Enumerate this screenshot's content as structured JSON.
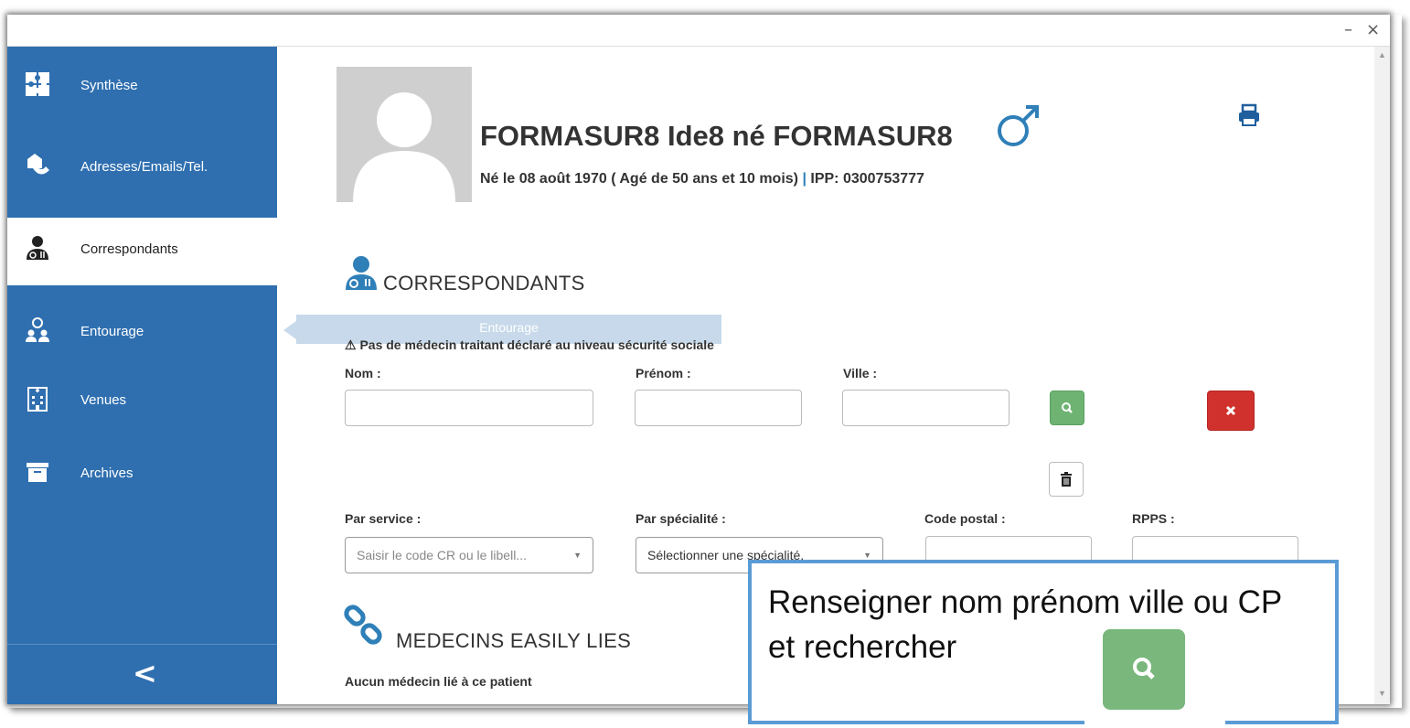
{
  "window": {
    "minimize_glyph": "–",
    "close_glyph": "×"
  },
  "sidebar": {
    "items": [
      {
        "label": "Synthèse",
        "icon": "puzzle-icon"
      },
      {
        "label": "Adresses/Emails/Tel.",
        "icon": "envelope-phone-icon"
      },
      {
        "label": "Correspondants",
        "icon": "doctor-icon",
        "active": true
      },
      {
        "label": "Entourage",
        "icon": "people-icon"
      },
      {
        "label": "Venues",
        "icon": "hospital-icon"
      },
      {
        "label": "Archives",
        "icon": "archive-box-icon"
      }
    ],
    "collapse_glyph": "<"
  },
  "patient": {
    "name": "FORMASUR8 Ide8 né FORMASUR8",
    "info": "Né le 08 août 1970 ( Agé de 50 ans et 10 mois)",
    "separator": "|",
    "ipp": "IPP: 0300753777"
  },
  "correspondants": {
    "title": "CORRESPONDANTS",
    "tooltip": "Entourage",
    "warning": "Pas de médecin traitant déclaré au niveau sécurité sociale",
    "labels": {
      "nom": "Nom :",
      "prenom": "Prénom :",
      "ville": "Ville :",
      "service": "Par service :",
      "specialite": "Par spécialité :",
      "code_postal": "Code postal :",
      "rpps": "RPPS :"
    },
    "values": {
      "nom": "",
      "prenom": "",
      "ville": "",
      "code_postal": "",
      "rpps": ""
    },
    "service_placeholder": "Saisir le code CR ou le libell...",
    "specialite_placeholder": "Sélectionner une spécialité."
  },
  "liens": {
    "title": "MEDECINS EASILY LIES",
    "empty_text": "Aucun médecin lié à ce patient"
  },
  "callout": {
    "text": "Renseigner nom prénom ville ou CP et rechercher"
  },
  "colors": {
    "sidebar": "#2f6fb0",
    "accent": "#2f7fb8",
    "search_green": "#6fb373",
    "clear_red": "#d0312d",
    "callout_border": "#5b9bd5"
  }
}
